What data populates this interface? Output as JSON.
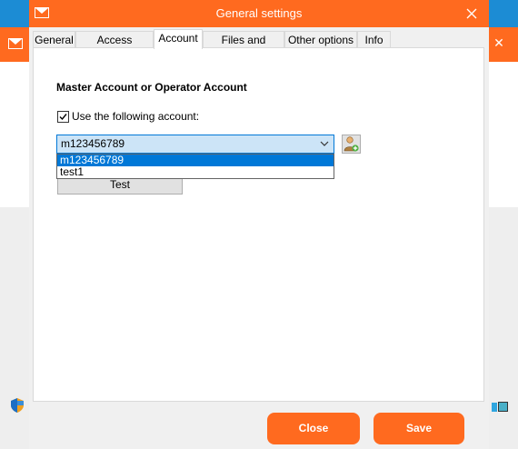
{
  "window": {
    "title": "General settings",
    "accent_color": "#ff6a1f",
    "close_icon": "close-icon"
  },
  "tabs": [
    {
      "label": "General"
    },
    {
      "label": "Access Account"
    },
    {
      "label": "Account",
      "active": true
    },
    {
      "label": "Files and folders"
    },
    {
      "label": "Other options"
    },
    {
      "label": "Info"
    }
  ],
  "account": {
    "section_title": "Master Account or Operator Account",
    "use_account_label": "Use the following account:",
    "use_account_checked": true,
    "selected_account": "m123456789",
    "options": [
      "m123456789",
      "test1"
    ],
    "add_user_icon": "add-user-icon",
    "test_button": "Test"
  },
  "footer": {
    "close_label": "Close",
    "save_label": "Save"
  }
}
